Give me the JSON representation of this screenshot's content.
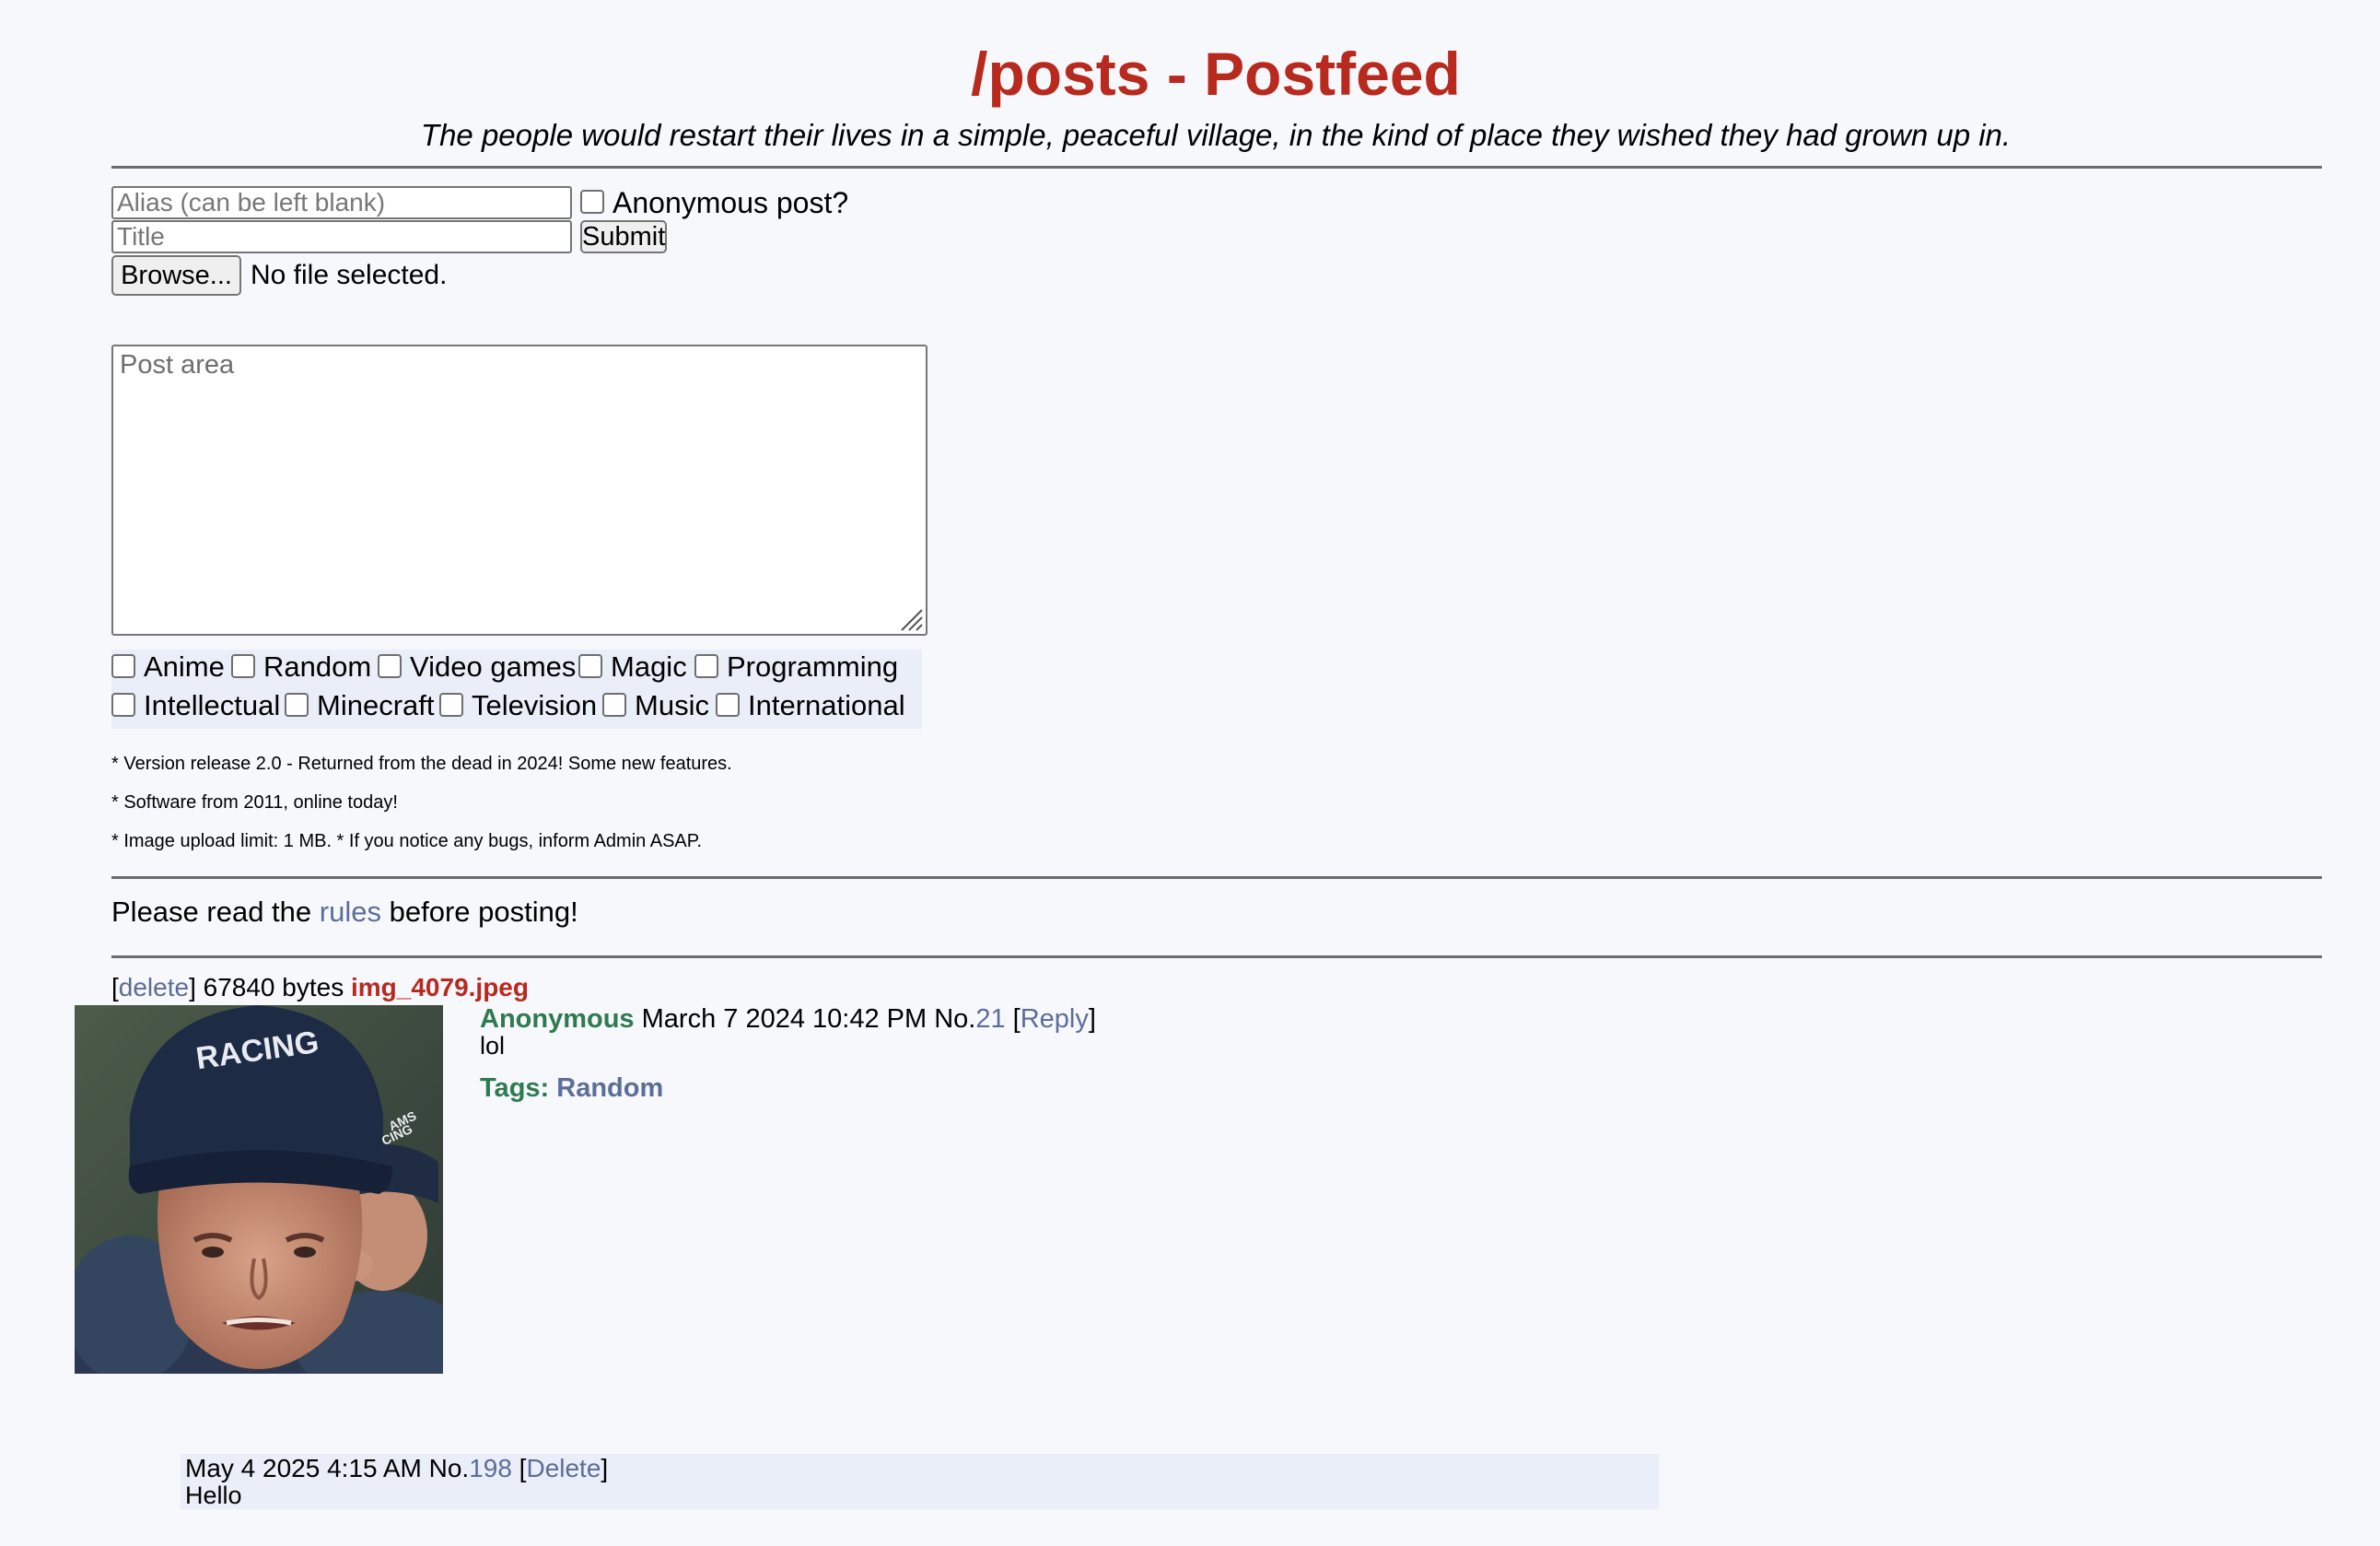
{
  "header": {
    "title": "/posts - Postfeed",
    "subtitle": "The people would restart their lives in a simple, peaceful village, in the kind of place they wished they had grown up in."
  },
  "form": {
    "alias_placeholder": "Alias (can be left blank)",
    "alias_value": "",
    "anonymous_label": "Anonymous post?",
    "title_placeholder": "Title",
    "title_value": "",
    "submit_label": "Submit",
    "browse_label": "Browse...",
    "file_status": "No file selected.",
    "post_placeholder": "Post area",
    "post_value": "",
    "tags": [
      {
        "label": "Anime"
      },
      {
        "label": "Random"
      },
      {
        "label": "Video games"
      },
      {
        "label": "Magic"
      },
      {
        "label": "Programming"
      },
      {
        "label": "Intellectual"
      },
      {
        "label": "Minecraft"
      },
      {
        "label": "Television"
      },
      {
        "label": "Music"
      },
      {
        "label": "International"
      }
    ]
  },
  "notes": [
    "* Version release 2.0 - Returned from the dead in 2024! Some new features.",
    "* Software from 2011, online today!",
    "* Image upload limit: 1 MB. * If you notice any bugs, inform Admin ASAP."
  ],
  "rules_notice": {
    "before": "Please read the",
    "link": "rules",
    "after": "before posting!"
  },
  "post": {
    "delete_label": "delete",
    "file_size": "67840 bytes",
    "file_name": "img_4079.jpeg",
    "author": "Anonymous",
    "timestamp": "March 7 2024 10:42 PM",
    "number_prefix": "No.",
    "number": "21",
    "reply_label": "Reply",
    "body": "lol",
    "tags_label": "Tags:",
    "tags_value": "Random",
    "image_caption_cap": "RACING",
    "image_caption_cap2": "AMS",
    "image_caption_cap3": "CING",
    "reply": {
      "timestamp": "May 4 2025 4:15 AM",
      "number_prefix": "No.",
      "number": "198",
      "delete_label": "Delete",
      "body": "Hello"
    }
  },
  "colors": {
    "background": "#f7f8fc",
    "title": "#b8291e",
    "link": "#5b6e98",
    "author": "#2f7a4f",
    "panel": "#eaeef9"
  }
}
